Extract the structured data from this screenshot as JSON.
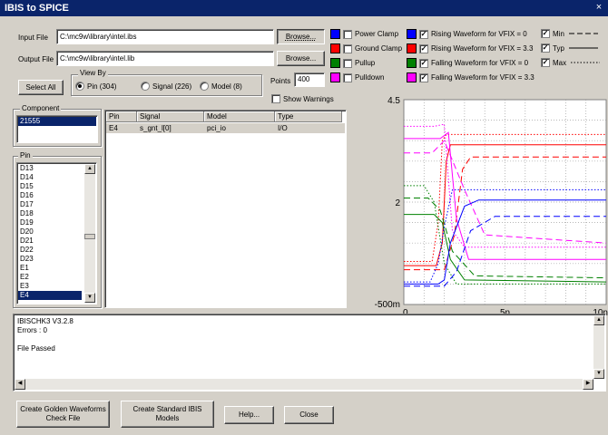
{
  "window": {
    "title": "IBIS to SPICE",
    "close_glyph": "×"
  },
  "files": {
    "input_label": "Input File",
    "input_value": "C:\\mc9w\\library\\intel.ibs",
    "output_label": "Output File",
    "output_value": "C:\\mc9w\\library\\intel.lib",
    "browse_label": "Browse..."
  },
  "view_by": {
    "title": "View By",
    "select_all": "Select All",
    "options": [
      "Pin (304)",
      "Signal (226)",
      "Model (8)"
    ],
    "selected": "Pin (304)"
  },
  "points": {
    "label": "Points",
    "value": "400"
  },
  "show_warnings": {
    "label": "Show Warnings",
    "checked": false
  },
  "waveform_toggles": [
    {
      "label": "Power Clamp",
      "color": "#0000ff",
      "checked": false
    },
    {
      "label": "Ground Clamp",
      "color": "#ff0000",
      "checked": false
    },
    {
      "label": "Pullup",
      "color": "#008000",
      "checked": false
    },
    {
      "label": "Pulldown",
      "color": "#ff00ff",
      "checked": false
    }
  ],
  "rising_falling": [
    {
      "label": "Rising Waveform for VFIX = 0",
      "color": "#0000ff",
      "checked": true
    },
    {
      "label": "Rising Waveform for VFIX = 3.3",
      "color": "#ff0000",
      "checked": true
    },
    {
      "label": "Falling Waveform for VFIX = 0",
      "color": "#008000",
      "checked": true
    },
    {
      "label": "Falling Waveform for VFIX = 3.3",
      "color": "#ff00ff",
      "checked": true
    }
  ],
  "corners": [
    {
      "label": "Min",
      "checked": true,
      "line": "long-dash"
    },
    {
      "label": "Typ",
      "checked": true,
      "line": "solid"
    },
    {
      "label": "Max",
      "checked": true,
      "line": "dotted"
    }
  ],
  "component": {
    "title": "Component",
    "items": [
      "21555"
    ],
    "selected": "21555"
  },
  "pin_list": {
    "title": "Pin",
    "items": [
      "D13",
      "D14",
      "D15",
      "D16",
      "D17",
      "D18",
      "D19",
      "D20",
      "D21",
      "D22",
      "D23",
      "E1",
      "E2",
      "E3",
      "E4"
    ],
    "selected": "E4"
  },
  "table": {
    "columns": [
      "Pin",
      "Signal",
      "Model",
      "Type"
    ],
    "rows": [
      {
        "pin": "E4",
        "signal": "s_gnt_l[0]",
        "model": "pci_io",
        "type": "I/O"
      }
    ]
  },
  "chart_data": {
    "type": "line",
    "title": "",
    "xlabel": "",
    "ylabel": "",
    "x_ticks": [
      "0",
      "5n",
      "10n"
    ],
    "y_ticks": [
      "4.5",
      "2",
      "-500m"
    ],
    "xlim": [
      0,
      10
    ],
    "ylim": [
      -0.5,
      4.5
    ],
    "x_unit": "ns",
    "grid": true,
    "series": [
      {
        "color": "#ff0000",
        "dash": "solid",
        "x": [
          0,
          1.6,
          1.9,
          2.1,
          2.3,
          10
        ],
        "y": [
          0.45,
          0.45,
          1.0,
          3.0,
          3.4,
          3.4
        ]
      },
      {
        "color": "#ff0000",
        "dash": "long-dash",
        "x": [
          0,
          2.0,
          2.5,
          2.9,
          3.3,
          10
        ],
        "y": [
          0.35,
          0.35,
          1.2,
          2.8,
          3.1,
          3.1
        ]
      },
      {
        "color": "#ff0000",
        "dash": "dotted",
        "x": [
          0,
          1.4,
          1.7,
          1.9,
          2.1,
          10
        ],
        "y": [
          0.55,
          0.55,
          1.5,
          3.5,
          3.65,
          3.65
        ]
      },
      {
        "color": "#ff00ff",
        "dash": "solid",
        "x": [
          0,
          1.8,
          2.2,
          2.6,
          3.2,
          10
        ],
        "y": [
          3.55,
          3.55,
          3.7,
          1.6,
          0.6,
          0.6
        ]
      },
      {
        "color": "#ff00ff",
        "dash": "long-dash",
        "x": [
          0,
          1.4,
          2.0,
          3.0,
          4.0,
          10
        ],
        "y": [
          3.2,
          3.2,
          3.5,
          2.3,
          1.2,
          1.0
        ]
      },
      {
        "color": "#ff00ff",
        "dash": "dotted",
        "x": [
          0,
          1.5,
          2.0,
          2.4,
          3.0,
          10
        ],
        "y": [
          3.85,
          3.85,
          3.9,
          1.3,
          0.9,
          0.9
        ]
      },
      {
        "color": "#008000",
        "dash": "solid",
        "x": [
          0,
          1.5,
          1.9,
          2.3,
          3.0,
          10
        ],
        "y": [
          1.7,
          1.7,
          1.5,
          0.6,
          0.1,
          0.05
        ]
      },
      {
        "color": "#008000",
        "dash": "long-dash",
        "x": [
          0,
          1.2,
          1.8,
          2.4,
          3.5,
          10
        ],
        "y": [
          2.1,
          2.1,
          1.8,
          0.8,
          0.2,
          0.15
        ]
      },
      {
        "color": "#008000",
        "dash": "dotted",
        "x": [
          0,
          1.0,
          1.5,
          2.0,
          2.6,
          10
        ],
        "y": [
          2.4,
          2.4,
          2.0,
          0.5,
          0.0,
          0.0
        ]
      },
      {
        "color": "#0000ff",
        "dash": "solid",
        "x": [
          0,
          1.7,
          2.0,
          2.3,
          3.0,
          3.7,
          10
        ],
        "y": [
          0.0,
          0.0,
          0.1,
          1.0,
          1.9,
          2.05,
          2.05
        ]
      },
      {
        "color": "#0000ff",
        "dash": "long-dash",
        "x": [
          0,
          2.0,
          2.6,
          3.3,
          4.5,
          10
        ],
        "y": [
          -0.05,
          -0.05,
          0.3,
          1.3,
          1.65,
          1.65
        ]
      },
      {
        "color": "#0000ff",
        "dash": "dotted",
        "x": [
          0,
          1.3,
          1.7,
          2.0,
          2.4,
          10
        ],
        "y": [
          0.05,
          0.05,
          0.5,
          1.4,
          2.3,
          2.3
        ]
      }
    ]
  },
  "log": {
    "lines": [
      "IBISCHK3 V3.2.8",
      "Errors : 0",
      "",
      "File Passed"
    ]
  },
  "footer": {
    "golden": [
      "Create Golden Waveforms",
      "Check File"
    ],
    "standard": [
      "Create Standard IBIS",
      "Models"
    ],
    "help": "Help...",
    "close": "Close"
  }
}
